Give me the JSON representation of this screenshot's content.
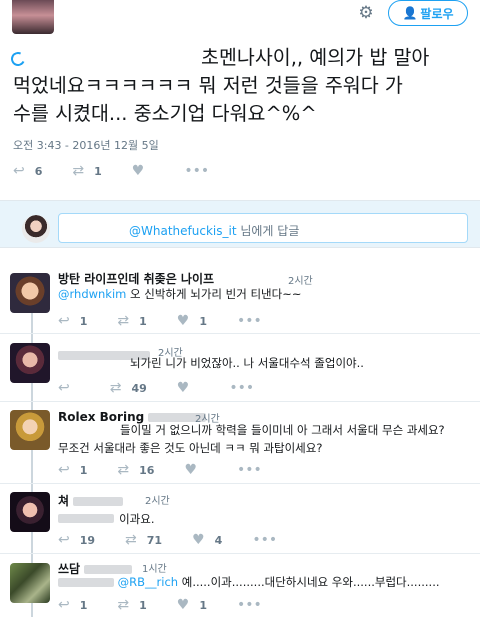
{
  "header": {
    "follow_label": "팔로우",
    "settings_icon": "gear-icon"
  },
  "main_tweet": {
    "line1": "초멘나사이,, 예의가 밥 말아",
    "line2": "먹었네요ㅋㅋㅋㅋㅋㅋ 뭐 저런 것들을 주워다 가",
    "line3": "수를 시켰대... 중소기업 다워요^%^",
    "timestamp": "오전 3:43 - 2016년 12월 5일",
    "reply_count": "6",
    "retweet_count": "1"
  },
  "reply_box": {
    "mention": "@Whathefuckis_it",
    "suffix": " 님에게 답글"
  },
  "replies": [
    {
      "name": "방탄 라이프인데 취좆은 나이프",
      "time": "2시간",
      "mention": "@rhdwnkim",
      "text": " 오 신박하게 뇌가리 빈거 티낸다~~",
      "reply_count": "1",
      "retweet_count": "1",
      "like_count": "1"
    },
    {
      "name": "",
      "time": "2시간",
      "text": "뇌가린 니가 비었잖아.. 나 서울대수석 졸업이야..",
      "reply_count": "",
      "retweet_count": "49",
      "like_count": ""
    },
    {
      "name": "Rolex Boring",
      "time": "2시간",
      "text_line1": "들이밀 거 없으니까 학력을 들이미네 아 그래서 서울대 무슨 과세요?",
      "text_line2": "무조건 서울대라 좋은 것도 아닌데 ㅋㅋ 뭐 과탑이세요?",
      "reply_count": "1",
      "retweet_count": "16",
      "like_count": ""
    },
    {
      "name": "쳐",
      "time": "2시간",
      "text": "이과요.",
      "reply_count": "19",
      "retweet_count": "71",
      "like_count": "4"
    },
    {
      "name": "쓰담",
      "time": "1시간",
      "mention": "@RB__rich",
      "text": " 예.....이과.........대단하시네요 우와......부럽다.........",
      "reply_count": "1",
      "retweet_count": "1",
      "like_count": "1"
    }
  ],
  "icons": {
    "reply": "reply-icon",
    "retweet": "retweet-icon",
    "like": "heart-icon",
    "more": "more-icon"
  },
  "colors": {
    "accent": "#1da1f2",
    "muted": "#657786",
    "icon": "#aab8c2",
    "reply_bar": "#e8f4fb"
  }
}
